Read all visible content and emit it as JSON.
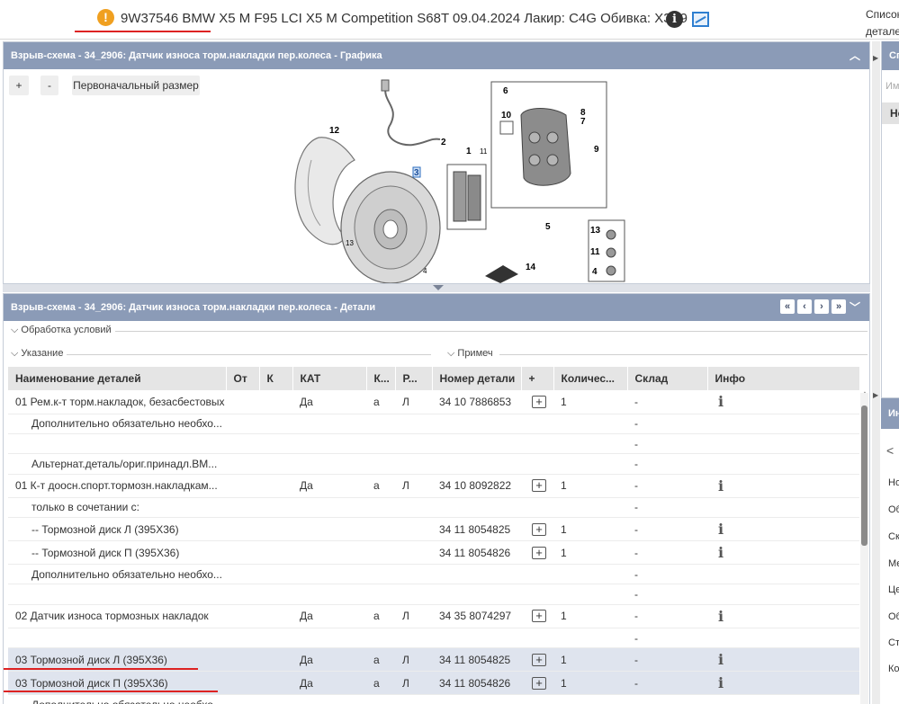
{
  "header": {
    "warning_icon": "exclamation-icon",
    "vehicle_title": "9W37546 BMW X5 M F95 LCI X5 M Competition S68T 09.04.2024 Лакир: C4G Обивка: X3A9",
    "info_icon": "i",
    "side_text_line1": "Список",
    "side_text_line2": "детале"
  },
  "graphic_panel": {
    "title": "Взрыв-схема - 34_2906: Датчик износа торм.накладки пер.колеса - Графика",
    "zoom_in_label": "+",
    "zoom_out_label": "-",
    "reset_label": "Первоначальный размер",
    "callouts": [
      "12",
      "2",
      "1",
      "11",
      "3",
      "13",
      "4",
      "6",
      "10",
      "8",
      "7",
      "9",
      "5",
      "13",
      "11",
      "4",
      "14"
    ]
  },
  "details_panel": {
    "title": "Взрыв-схема - 34_2906: Датчик износа торм.накладки пер.колеса - Детали",
    "nav": [
      "«",
      "‹",
      "›",
      "»"
    ],
    "filter_conditions": "Обработка условий",
    "filter_note": "Указание",
    "filter_remark": "Примеч",
    "columns": [
      "Наименование деталей",
      "От",
      "К",
      "КАТ",
      "К...",
      "Р...",
      "Номер детали",
      "+",
      "Количес...",
      "Склад",
      "Инфо"
    ],
    "rows": [
      {
        "name": "01 Рем.к-т торм.накладок, безасбестовых",
        "kat": "Да",
        "k": "а",
        "r": "Л",
        "number": "34 10 7886853",
        "qty": "1",
        "stock": "-",
        "sub": false,
        "plus": true,
        "info": true,
        "hl": false
      },
      {
        "name": "Дополнительно обязательно необхо...",
        "kat": "",
        "k": "",
        "r": "",
        "number": "",
        "qty": "",
        "stock": "-",
        "sub": true,
        "plus": false,
        "info": false,
        "hl": false
      },
      {
        "name": "",
        "kat": "",
        "k": "",
        "r": "",
        "number": "",
        "qty": "",
        "stock": "-",
        "sub": true,
        "plus": false,
        "info": false,
        "hl": false
      },
      {
        "name": "Альтернат.деталь/ориг.принадл.BM...",
        "kat": "",
        "k": "",
        "r": "",
        "number": "",
        "qty": "",
        "stock": "-",
        "sub": true,
        "plus": false,
        "info": false,
        "hl": false
      },
      {
        "name": "01 К-т доосн.спорт.тормозн.накладкам...",
        "kat": "Да",
        "k": "а",
        "r": "Л",
        "number": "34 10 8092822",
        "qty": "1",
        "stock": "-",
        "sub": false,
        "plus": true,
        "info": true,
        "hl": false
      },
      {
        "name": "только в сочетании с:",
        "kat": "",
        "k": "",
        "r": "",
        "number": "",
        "qty": "",
        "stock": "-",
        "sub": true,
        "plus": false,
        "info": false,
        "hl": false
      },
      {
        "name": "-- Тормозной диск Л (395X36)",
        "kat": "",
        "k": "",
        "r": "",
        "number": "34 11 8054825",
        "qty": "1",
        "stock": "-",
        "sub": true,
        "plus": true,
        "info": true,
        "hl": false
      },
      {
        "name": "-- Тормозной диск П (395X36)",
        "kat": "",
        "k": "",
        "r": "",
        "number": "34 11 8054826",
        "qty": "1",
        "stock": "-",
        "sub": true,
        "plus": true,
        "info": true,
        "hl": false
      },
      {
        "name": "Дополнительно обязательно необхо...",
        "kat": "",
        "k": "",
        "r": "",
        "number": "",
        "qty": "",
        "stock": "-",
        "sub": true,
        "plus": false,
        "info": false,
        "hl": false
      },
      {
        "name": "",
        "kat": "",
        "k": "",
        "r": "",
        "number": "",
        "qty": "",
        "stock": "-",
        "sub": true,
        "plus": false,
        "info": false,
        "hl": false
      },
      {
        "name": "02 Датчик износа тормозных накладок",
        "kat": "Да",
        "k": "а",
        "r": "Л",
        "number": "34 35 8074297",
        "qty": "1",
        "stock": "-",
        "sub": false,
        "plus": true,
        "info": true,
        "hl": false
      },
      {
        "name": "",
        "kat": "",
        "k": "",
        "r": "",
        "number": "",
        "qty": "",
        "stock": "-",
        "sub": true,
        "plus": false,
        "info": false,
        "hl": false
      },
      {
        "name": "03 Тормозной диск Л (395X36)",
        "kat": "Да",
        "k": "а",
        "r": "Л",
        "number": "34 11 8054825",
        "qty": "1",
        "stock": "-",
        "sub": false,
        "plus": true,
        "info": true,
        "hl": true
      },
      {
        "name": "03 Тормозной диск П (395X36)",
        "kat": "Да",
        "k": "а",
        "r": "Л",
        "number": "34 11 8054826",
        "qty": "1",
        "stock": "-",
        "sub": false,
        "plus": true,
        "info": true,
        "hl": true
      },
      {
        "name": "Дополнительно обязательно необхо...",
        "kat": "",
        "k": "",
        "r": "",
        "number": "",
        "qty": "",
        "stock": "",
        "sub": true,
        "plus": false,
        "info": false,
        "hl": false
      }
    ]
  },
  "right_panel_top": {
    "title": "Сп",
    "input_placeholder": "Им",
    "row_label": "Не"
  },
  "right_panel_bottom": {
    "title": "Ин",
    "items": [
      "Но",
      "Об",
      "Ск",
      "Ме",
      "Це",
      "Об",
      "Ст",
      "Ко"
    ]
  },
  "colors": {
    "header_bg": "#8b9bb7",
    "highlight_row": "#dfe4ee",
    "annotation_red": "#dd2222",
    "warning": "#f0a020"
  }
}
